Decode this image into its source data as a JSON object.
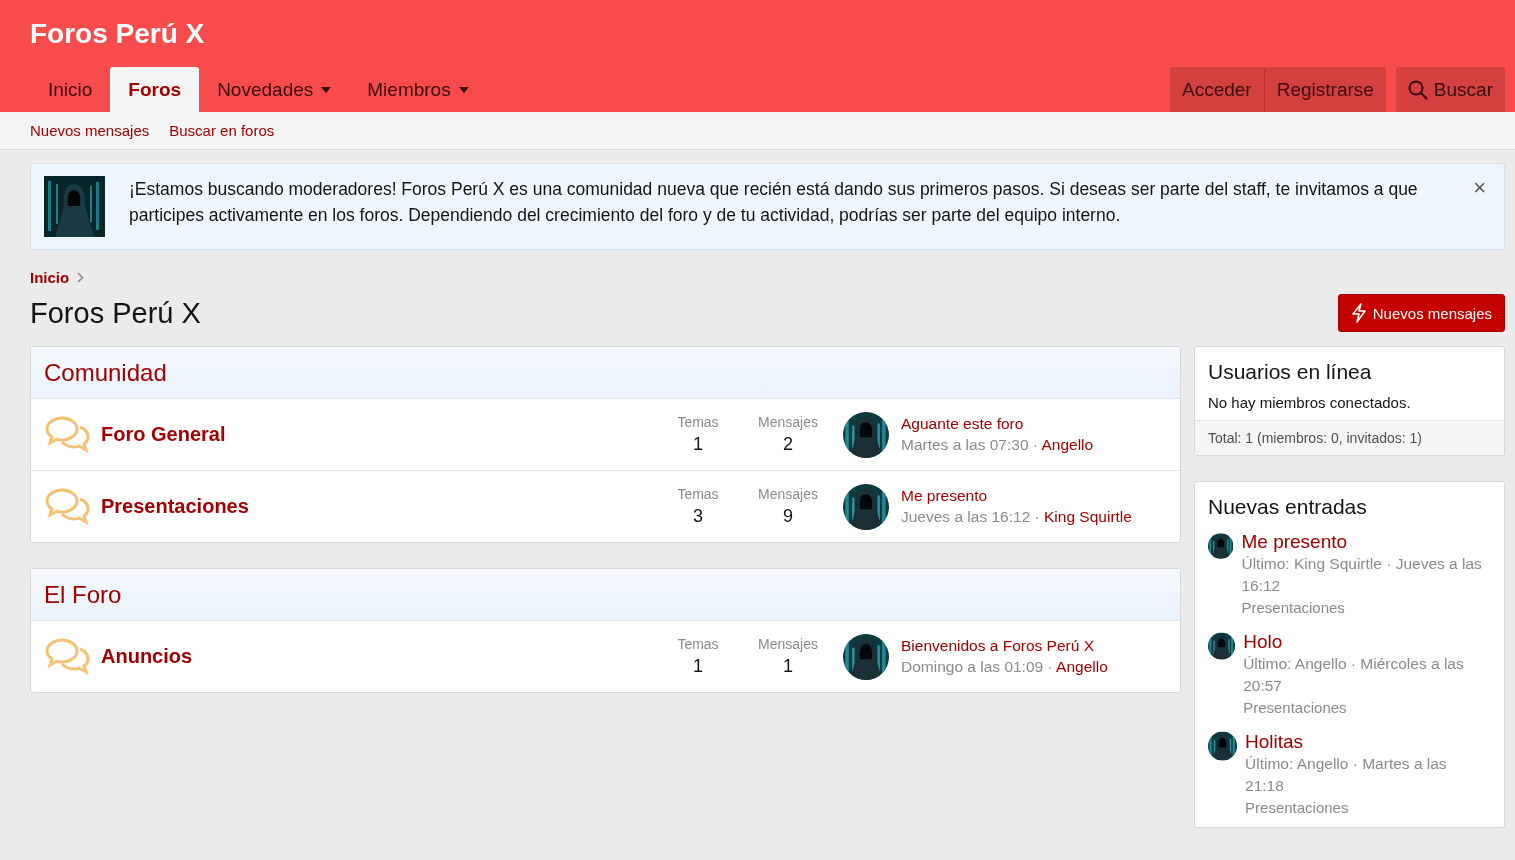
{
  "site_title": "Foros Perú X",
  "tabs": [
    {
      "label": "Inicio",
      "selected": false,
      "dropdown": false
    },
    {
      "label": "Foros",
      "selected": true,
      "dropdown": false
    },
    {
      "label": "Novedades",
      "selected": false,
      "dropdown": true
    },
    {
      "label": "Miembros",
      "selected": false,
      "dropdown": true
    }
  ],
  "account_buttons": [
    "Acceder",
    "Registrarse"
  ],
  "search_button": "Buscar",
  "subnav": [
    "Nuevos mensajes",
    "Buscar en foros"
  ],
  "notice": {
    "kind": "picture",
    "text": "¡Estamos buscando moderadores! Foros Perú X es una comunidad nueva que recién está dando sus primeros pasos. Si deseas ser parte del staff, te invitamos a que participes activamente en los foros. Dependiendo del crecimiento del foro y de tu actividad, podrías ser parte del equipo interno.",
    "close": "×"
  },
  "breadcrumb": [
    "Inicio"
  ],
  "page_title": "Foros Perú X",
  "new_posts_button": "Nuevos mensajes",
  "categories": [
    {
      "title": "Comunidad",
      "forums": [
        {
          "name": "Foro General",
          "threads_label": "Temas",
          "threads": "1",
          "messages_label": "Mensajes",
          "messages": "2",
          "last_title": "Aguante este foro",
          "last_date": "Martes a las 07:30 · ",
          "last_user": "Angello"
        },
        {
          "name": "Presentaciones",
          "threads_label": "Temas",
          "threads": "3",
          "messages_label": "Mensajes",
          "messages": "9",
          "last_title": "Me presento",
          "last_date": "Jueves a las 16:12 · ",
          "last_user": "King Squirtle"
        }
      ]
    },
    {
      "title": "El Foro",
      "forums": [
        {
          "name": "Anuncios",
          "threads_label": "Temas",
          "threads": "1",
          "messages_label": "Mensajes",
          "messages": "1",
          "last_title": "Bienvenidos a Foros Perú X",
          "last_date": "Domingo a las 01:09 · ",
          "last_user": "Angello"
        }
      ]
    }
  ],
  "online": {
    "title": "Usuarios en línea",
    "text": "No hay miembros conectados.",
    "footer": "Total: 1 (miembros: 0, invitados: 1)"
  },
  "new_entries": {
    "title": "Nuevas entradas",
    "items": [
      {
        "title": "Me presento",
        "meta": "Último: King Squirtle · Jueves a las 16:12",
        "forum": "Presentaciones"
      },
      {
        "title": "Holo",
        "meta": "Último: Angello · Miércoles a las 20:57",
        "forum": "Presentaciones"
      },
      {
        "title": "Holitas",
        "meta": "Último: Angello · Martes a las 21:18",
        "forum": "Presentaciones"
      }
    ]
  }
}
